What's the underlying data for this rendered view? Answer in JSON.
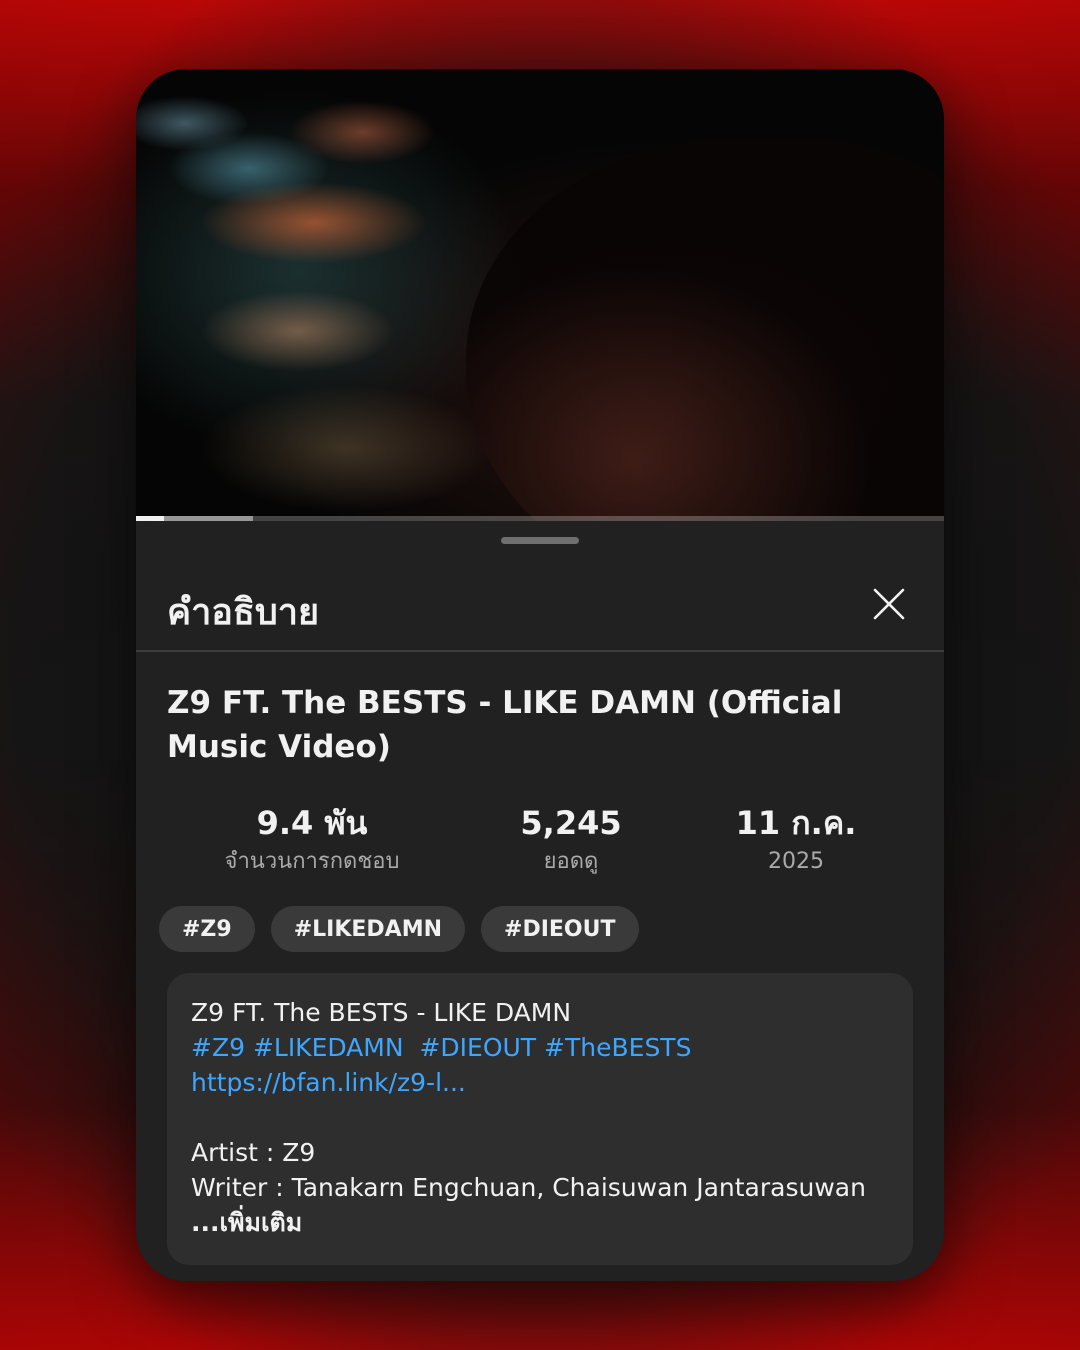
{
  "player": {
    "progress_played": 0.035,
    "progress_buffered": 0.145
  },
  "sheet": {
    "title": "คำอธิบาย",
    "close_icon": "close-icon"
  },
  "video": {
    "title": "Z9 FT. The BESTS - LIKE DAMN (Official Music Video)"
  },
  "stats": {
    "likes_value": "9.4 พัน",
    "likes_label": "จำนวนการกดชอบ",
    "views_value": "5,245",
    "views_label": "ยอดดู",
    "date_value": "11 ก.ค.",
    "date_year": "2025"
  },
  "hashtags": [
    "#Z9",
    "#LIKEDAMN",
    "#DIEOUT"
  ],
  "description": {
    "line1": "Z9 FT. The BESTS - LIKE DAMN",
    "tag1": "#Z9",
    "tag2": "#LIKEDAMN",
    "tag3": "#DIEOUT",
    "tag4": "#TheBESTS",
    "link": "https://bfan.link/z9-l...",
    "artist": "Artist : Z9",
    "writer": "Writer : Tanakarn Engchuan, Chaisuwan Jantarasuwan",
    "more": "...เพิ่มเติม"
  },
  "colors": {
    "accent_link": "#3ea6ff",
    "background_red": "#c40808",
    "sheet_bg": "#212121"
  }
}
